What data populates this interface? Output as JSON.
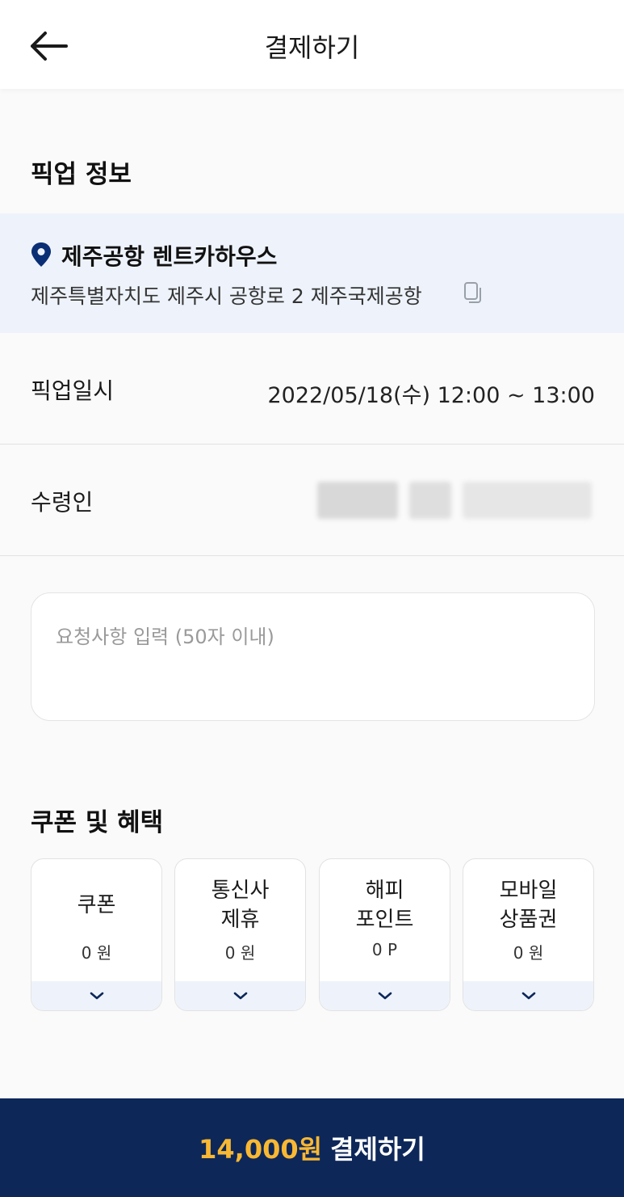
{
  "header": {
    "title": "결제하기",
    "back_icon": "arrow-left-icon"
  },
  "pickup": {
    "section_title": "픽업 정보",
    "location_name": "제주공항 렌트카하우스",
    "location_address": "제주특별자치도 제주시 공항로 2 제주국제공항",
    "pin_icon": "location-pin-icon",
    "copy_icon": "copy-icon",
    "pickup_label": "픽업일시",
    "pickup_value": "2022/05/18(수) 12:00 ~ 13:00",
    "receiver_label": "수령인"
  },
  "request": {
    "placeholder": "요청사항 입력 (50자 이내)",
    "value": ""
  },
  "benefits": {
    "section_title": "쿠폰 및 혜택",
    "cards": [
      {
        "line1": "쿠폰",
        "line2": "",
        "value": "0 원"
      },
      {
        "line1": "통신사",
        "line2": "제휴",
        "value": "0 원"
      },
      {
        "line1": "해피",
        "line2": "포인트",
        "value": "0 P"
      },
      {
        "line1": "모바일",
        "line2": "상품권",
        "value": "0 원"
      }
    ],
    "expand_icon": "chevron-down-icon"
  },
  "pay": {
    "amount": "14,000원",
    "label": "결제하기"
  },
  "colors": {
    "brand_navy": "#0d2759",
    "amount_yellow": "#f9b833",
    "highlight_bg": "#eef3fb",
    "pin_blue": "#0b2f74"
  }
}
